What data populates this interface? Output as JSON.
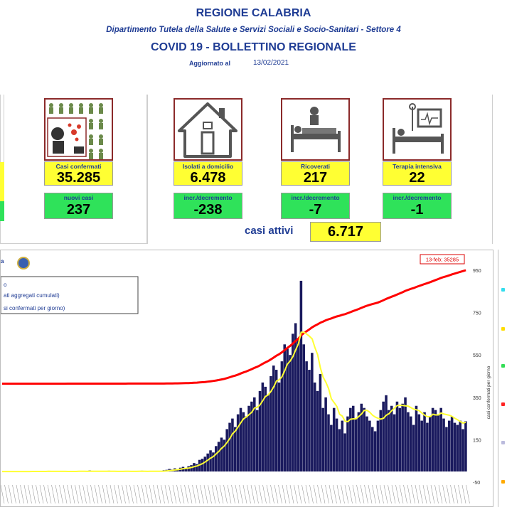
{
  "header": {
    "region": "REGIONE CALABRIA",
    "department": "Dipartimento Tutela della Salute e Servizi Sociali e Socio-Sanitari - Settore 4",
    "title": "COVID 19 - BOLLETTINO REGIONALE",
    "updated_label": "Aggiornato al",
    "updated_date": "13/02/2021"
  },
  "cards": {
    "confermati": {
      "label": "Casi confermati",
      "value": "35.285",
      "sub_label": "nuovi casi",
      "sub_value": "237"
    },
    "domicilio": {
      "label": "Isolati a domicilio",
      "value": "6.478",
      "sub_label": "incr./decremento",
      "sub_value": "-238"
    },
    "ricoverati": {
      "label": "Ricoverati",
      "value": "217",
      "sub_label": "incr./decremento",
      "sub_value": "-7"
    },
    "intensiva": {
      "label": "Terapia intensiva",
      "value": "22",
      "sub_label": "incr./decremento",
      "sub_value": "-1"
    }
  },
  "attivi": {
    "label": "casi attivi",
    "value": "6.717"
  },
  "chart": {
    "legend_title_fragment": "a",
    "legend_items": [
      "o",
      "ati aggregati cumulati)",
      "si confermati per giorno)"
    ],
    "callout": "13-feb; 35285",
    "right_axis_label": "casi confermati per giorno",
    "right_ticks": [
      "950",
      "750",
      "550",
      "350",
      "150",
      "-50"
    ],
    "colors": {
      "bars": "#1a1a5e",
      "cumulative": "#ff0000",
      "average": "#ffff33"
    }
  },
  "chart_data": {
    "type": "bar",
    "xlabel": "",
    "ylabel": "casi confermati per giorno",
    "ylim": [
      -50,
      950
    ],
    "series": [
      {
        "values": [
          0,
          0,
          0,
          0,
          0,
          0,
          1,
          0,
          0,
          0,
          0,
          2,
          0,
          0,
          1,
          0,
          0,
          3,
          0,
          1,
          0,
          0,
          0,
          0,
          2,
          0,
          0,
          1,
          3,
          0,
          0,
          0,
          5,
          0,
          0,
          2,
          0,
          0,
          0,
          4,
          1,
          0,
          0,
          0,
          0,
          2,
          3,
          0,
          0,
          0,
          1,
          4,
          0,
          0,
          2,
          3,
          0,
          1,
          0,
          6,
          8,
          12,
          9,
          15,
          10,
          18,
          22,
          14,
          25,
          30,
          40,
          35,
          55,
          60,
          70,
          85,
          100,
          90,
          120,
          140,
          160,
          150,
          200,
          230,
          250,
          210,
          270,
          300,
          280,
          260,
          310,
          330,
          350,
          290,
          380,
          420,
          400,
          360,
          450,
          500,
          480,
          420,
          520,
          600,
          580,
          550,
          650,
          700,
          620,
          900,
          600,
          520,
          480,
          560,
          420,
          380,
          460,
          300,
          350,
          270,
          220,
          300,
          250,
          200,
          240,
          180,
          260,
          300,
          310,
          250,
          280,
          320,
          300,
          260,
          240,
          210,
          190,
          240,
          290,
          330,
          360,
          290,
          310,
          270,
          330,
          300,
          320,
          350,
          280,
          260,
          220,
          310,
          270,
          240,
          280,
          230,
          260,
          300,
          290,
          270,
          300,
          250,
          210,
          240,
          260,
          230,
          220,
          240,
          200,
          237
        ]
      },
      {
        "name": "cumulative",
        "values": [
          0
        ]
      }
    ],
    "annotations": [
      "13-feb; 35285"
    ]
  }
}
